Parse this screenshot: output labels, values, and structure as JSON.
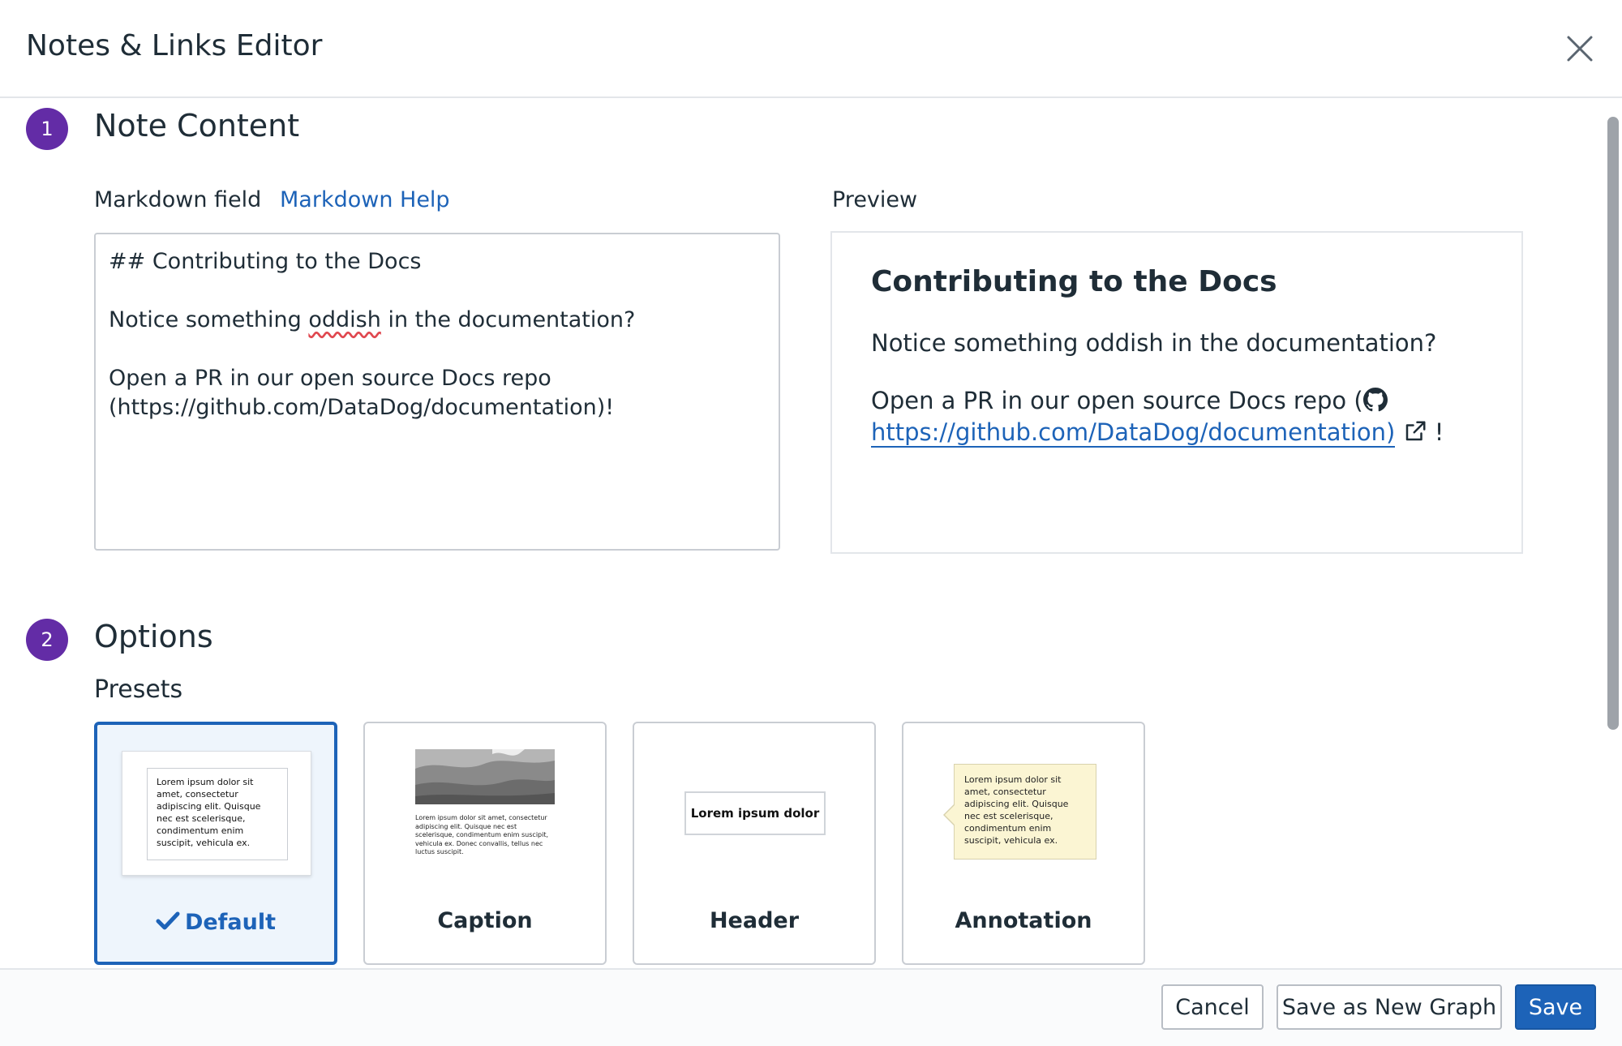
{
  "dialog": {
    "title": "Notes & Links Editor"
  },
  "section1": {
    "number": "1",
    "title": "Note Content"
  },
  "markdown": {
    "label": "Markdown field",
    "help_link": "Markdown Help",
    "lines": [
      "## Contributing to the Docs",
      "",
      "Notice something oddish in the documentation?",
      "",
      "Open a PR in our open source Docs repo",
      "(https://github.com/DataDog/documentation)!"
    ],
    "line3_before": "Notice something ",
    "line3_misspelled": "oddish",
    "line3_after": " in the documentation?"
  },
  "preview": {
    "label": "Preview",
    "heading": "Contributing to the Docs",
    "paragraph1": "Notice something oddish in the documentation?",
    "paragraph2_prefix": "Open a PR in our open source Docs repo (",
    "paragraph2_link": "https://github.com/DataDog/documentation)",
    "paragraph2_suffix": "!"
  },
  "section2": {
    "number": "2",
    "title": "Options",
    "presets_label": "Presets"
  },
  "presets": [
    {
      "label": "Default",
      "selected": true
    },
    {
      "label": "Caption",
      "selected": false
    },
    {
      "label": "Header",
      "selected": false
    },
    {
      "label": "Annotation",
      "selected": false
    }
  ],
  "thumbnails": {
    "lorem_short": "Lorem ipsum dolor sit amet, consectetur adipiscing elit. Quisque nec est scelerisque, condimentum enim suscipit, vehicula ex.",
    "lorem_caption": "Lorem ipsum dolor sit amet, consectetur adipiscing elit. Quisque nec est scelerisque, condimentum enim suscipit, vehicula ex. Donec convallis, tellus nec luctus suscipit.",
    "header_text": "Lorem ipsum dolor"
  },
  "footer": {
    "cancel": "Cancel",
    "save_new": "Save as New Graph",
    "save": "Save"
  },
  "colors": {
    "accent_purple": "#632ca6",
    "link_blue": "#1d63b8",
    "selected_bg": "#eef5fc",
    "annotation_bg": "#fbf5d3"
  },
  "icons": {
    "close": "close-icon",
    "check": "checkmark-icon",
    "github": "github-icon",
    "external": "external-link-icon"
  }
}
